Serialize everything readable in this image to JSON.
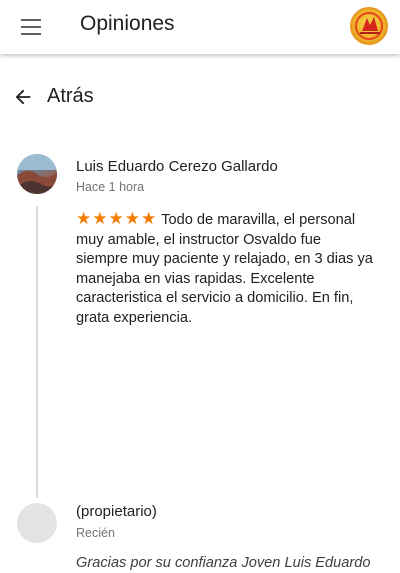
{
  "app_bar": {
    "title": "Opiniones",
    "menu_icon": "menu-icon",
    "logo_icon": "brand-logo"
  },
  "nav": {
    "back_icon": "arrow-back-icon",
    "back_label": "Atrás"
  },
  "review": {
    "author": "Luis Eduardo Cerezo Gallardo",
    "time": "Hace 1 hora",
    "rating": 5,
    "stars_text": "★★★★★",
    "text": "Todo de maravilla, el personal muy amable, el instructor Osvaldo fue siempre muy paciente y relajado, en 3 dias ya manejaba en vias rapidas. Excelente caracteristica el servicio a domicilio. En fin, grata experiencia."
  },
  "reply": {
    "author": "(propietario)",
    "time": "Recién",
    "text": "Gracias por su confianza Joven Luis Eduardo"
  },
  "colors": {
    "star": "#f57c00",
    "secondary_text": "#70757a",
    "thread_line": "#dadce0"
  }
}
